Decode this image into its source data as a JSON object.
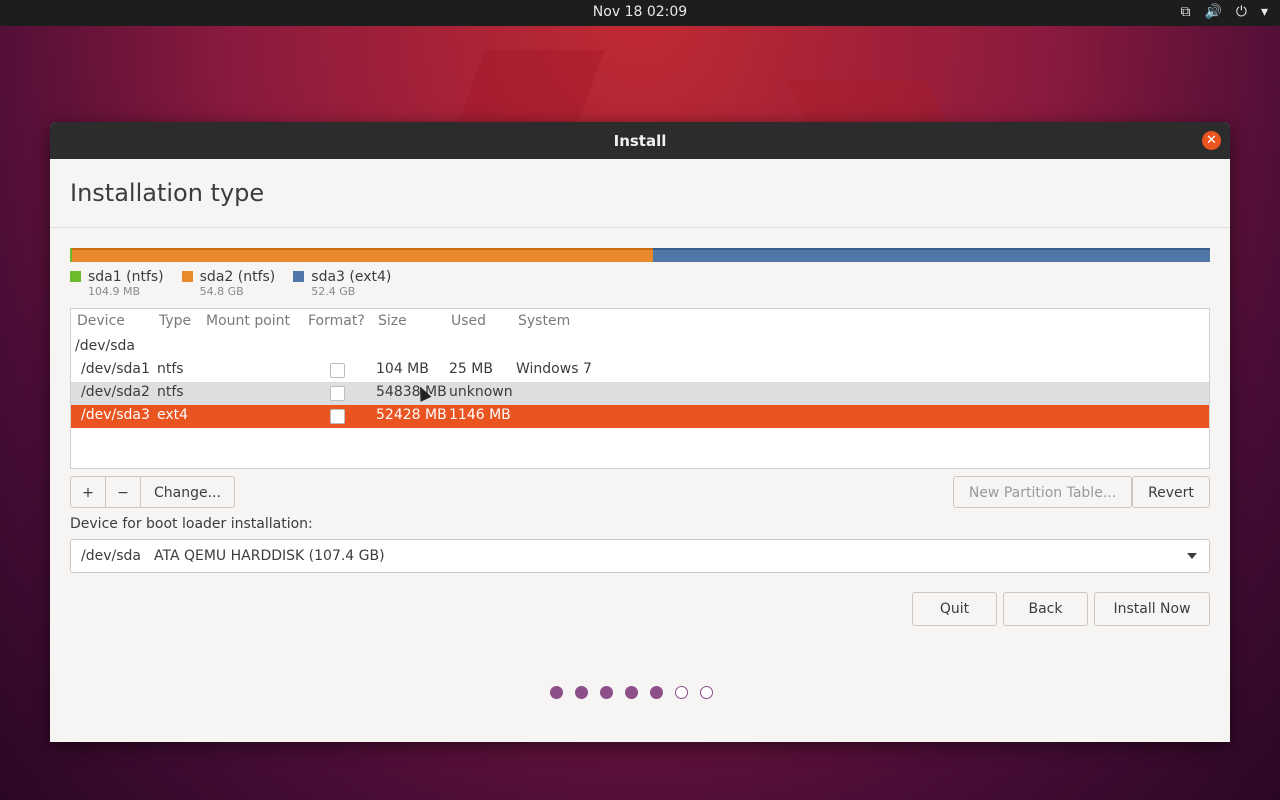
{
  "topbar": {
    "clock": "Nov 18  02:09"
  },
  "window": {
    "title": "Install",
    "page_title": "Installation type"
  },
  "colors": {
    "accent": "#e95420",
    "sda1": "#6dbb2a",
    "sda2": "#e88a2b",
    "sda3": "#4f78a8",
    "progress_dot": "#8c4f8a"
  },
  "legend": [
    {
      "name": "sda1 (ntfs)",
      "size": "104.9 MB",
      "color": "#6dbb2a"
    },
    {
      "name": "sda2 (ntfs)",
      "size": "54.8 GB",
      "color": "#e88a2b"
    },
    {
      "name": "sda3 (ext4)",
      "size": "52.4 GB",
      "color": "#4f78a8"
    }
  ],
  "table": {
    "headers": [
      "Device",
      "Type",
      "Mount point",
      "Format?",
      "Size",
      "Used",
      "System"
    ],
    "disk": "/dev/sda",
    "rows": [
      {
        "device": "/dev/sda1",
        "type": "ntfs",
        "mount": "",
        "size": "104 MB",
        "used": "25 MB",
        "system": "Windows 7"
      },
      {
        "device": "/dev/sda2",
        "type": "ntfs",
        "mount": "",
        "size": "54838 MB",
        "used": "unknown",
        "system": ""
      },
      {
        "device": "/dev/sda3",
        "type": "ext4",
        "mount": "",
        "size": "52428 MB",
        "used": "1146 MB",
        "system": ""
      }
    ]
  },
  "toolbar": {
    "add": "+",
    "remove": "−",
    "change": "Change...",
    "new_table": "New Partition Table...",
    "revert": "Revert"
  },
  "boot": {
    "label": "Device for boot loader installation:",
    "device": "/dev/sda",
    "description": "ATA QEMU HARDDISK (107.4 GB)"
  },
  "buttons": {
    "quit": "Quit",
    "back": "Back",
    "install": "Install Now"
  },
  "progress": {
    "total_steps": 7,
    "completed": 5
  }
}
